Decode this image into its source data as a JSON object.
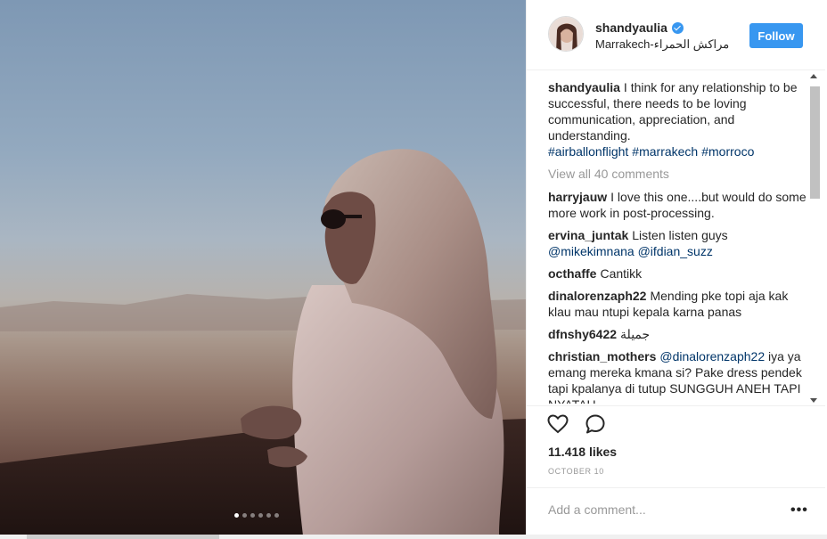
{
  "post": {
    "username": "shandyaulia",
    "location": "Marrakech-مراكش الحمراء",
    "follow_label": "Follow",
    "caption_text": "I think for any relationship to be successful, there needs to be loving communication, appreciation, and understanding.",
    "hashtags": [
      "#airballonflight",
      "#marrakech",
      "#morroco"
    ],
    "view_all": "View all 40 comments",
    "likes": "11.418 likes",
    "date": "OCTOBER 10",
    "add_comment_placeholder": "Add a comment...",
    "more_label": "•••"
  },
  "comments": [
    {
      "user": "harryjauw",
      "text": "I love this one....but would do some more work in post-processing."
    },
    {
      "user": "ervina_juntak",
      "text": "Listen listen guys",
      "mentions": "@mikekimnana @ifdian_suzz"
    },
    {
      "user": "octhaffe",
      "text": "Cantikk"
    },
    {
      "user": "dinalorenzaph22",
      "text": "Mending pke topi aja kak klau mau ntupi kepala karna panas"
    },
    {
      "user": "dfnshy6422",
      "text": "جميلة"
    },
    {
      "user": "christian_mothers",
      "mention": "@dinalorenzaph22",
      "text": "iya ya emang mereka kmana si? Pake dress pendek tapi kpalanya di tutup SUNGGUH ANEH TAPI NYATAH..."
    }
  ],
  "carousel": {
    "total": 6,
    "active": 0
  },
  "colors": {
    "accent": "#3897f0",
    "link": "#003569",
    "muted": "#999999"
  },
  "icons": [
    "verified-badge-icon",
    "heart-icon",
    "comment-bubble-icon",
    "more-options-icon"
  ]
}
